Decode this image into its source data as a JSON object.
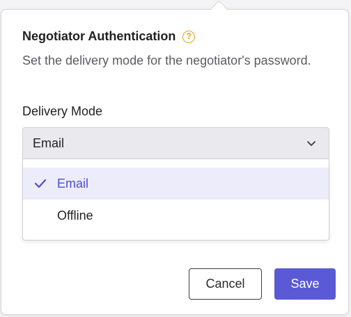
{
  "dialog": {
    "title": "Negotiator Authentication",
    "help_icon": "question-circle-icon",
    "help_glyph": "?",
    "description": "Set the delivery mode for the negotiator's password."
  },
  "delivery_mode": {
    "label": "Delivery Mode",
    "selected_value": "Email",
    "dropdown_icon": "chevron-down-icon",
    "options": [
      {
        "label": "Email",
        "selected": true
      },
      {
        "label": "Offline",
        "selected": false
      }
    ]
  },
  "actions": {
    "cancel_label": "Cancel",
    "save_label": "Save"
  },
  "colors": {
    "accent": "#5a5ad6",
    "selected_text": "#4f4fc4",
    "selected_bg": "#ececfb",
    "help_icon": "#e0a21b"
  }
}
